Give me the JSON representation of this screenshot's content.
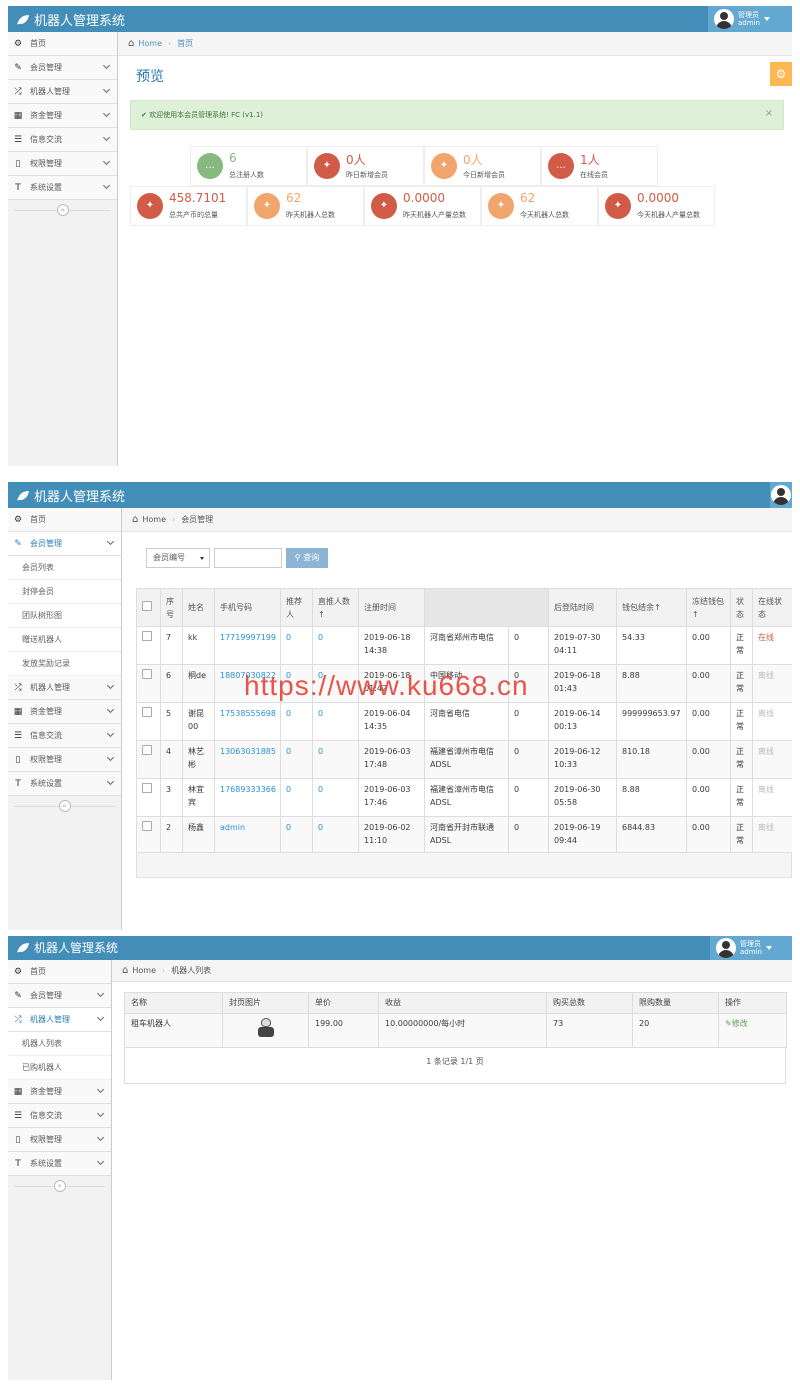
{
  "app_title": "机器人管理系统",
  "user": {
    "role": "管理员",
    "name": "admin"
  },
  "collapse_glyph": "«",
  "panel1": {
    "breadcrumb": {
      "home": "Home",
      "current": "首页"
    },
    "page_title": "预览",
    "alert": "✔ 欢迎使用本会员管理系统! FC (v1.1)",
    "alert_close": "×",
    "nav": [
      {
        "label": "首页",
        "icon": "dashboard-icon",
        "glyph": "⚙",
        "chevron": false
      },
      {
        "label": "会员管理",
        "icon": "edit-icon",
        "glyph": "✎",
        "chevron": true
      },
      {
        "label": "机器人管理",
        "icon": "random-icon",
        "glyph": "⤮",
        "chevron": true
      },
      {
        "label": "资金管理",
        "icon": "calendar-icon",
        "glyph": "▦",
        "chevron": true
      },
      {
        "label": "信息交流",
        "icon": "list-icon",
        "glyph": "☰",
        "chevron": true
      },
      {
        "label": "权限管理",
        "icon": "file-icon",
        "glyph": "▯",
        "chevron": true
      },
      {
        "label": "系统设置",
        "icon": "text-icon",
        "glyph": "T",
        "chevron": true
      }
    ],
    "stats_row1": [
      {
        "value": "6",
        "label": "总注册人数",
        "color": "#87b87f",
        "icon": "comments-icon",
        "glyph": "…"
      },
      {
        "value": "0人",
        "label": "昨日新增会员",
        "color": "#d15b47",
        "icon": "twitter-icon",
        "glyph": "✦"
      },
      {
        "value": "0人",
        "label": "今日新增会员",
        "color": "#f0a56c",
        "icon": "twitter-icon",
        "glyph": "✦"
      },
      {
        "value": "1人",
        "label": "在线会员",
        "color": "#d15b47",
        "icon": "comments-icon",
        "glyph": "…"
      }
    ],
    "stats_row2": [
      {
        "value": "458.7101",
        "label": "总共产币的总量",
        "color": "#d15b47",
        "icon": "twitter-icon",
        "glyph": "✦"
      },
      {
        "value": "62",
        "label": "昨天机器人总数",
        "color": "#f0a56c",
        "icon": "twitter-icon",
        "glyph": "✦"
      },
      {
        "value": "0.0000",
        "label": "昨天机器人产量总数",
        "color": "#d15b47",
        "icon": "twitter-icon",
        "glyph": "✦"
      },
      {
        "value": "62",
        "label": "今天机器人总数",
        "color": "#f0a56c",
        "icon": "twitter-icon",
        "glyph": "✦"
      },
      {
        "value": "0.0000",
        "label": "今天机器人产量总数",
        "color": "#d15b47",
        "icon": "twitter-icon",
        "glyph": "✦"
      }
    ]
  },
  "panel2": {
    "breadcrumb": {
      "home": "Home",
      "current": "会员管理"
    },
    "nav_top": {
      "label": "首页"
    },
    "nav_active": {
      "label": "会员管理"
    },
    "sub_items": [
      "会员列表",
      "封停会员",
      "团队树形图",
      "赠送机器人",
      "发放奖励记录"
    ],
    "nav_rest": [
      "机器人管理",
      "资金管理",
      "信息交流",
      "权限管理",
      "系统设置"
    ],
    "search": {
      "select": "会员编号",
      "button": "查询"
    },
    "columns": [
      "",
      "序号",
      "姓名",
      "手机号码",
      "推荐人",
      "直推人数↑",
      "注册时间",
      "",
      "",
      "后登陆时间",
      "钱包结余↑",
      "冻结钱包↑",
      "状态",
      "在线状态"
    ],
    "rows": [
      [
        "7",
        "kk",
        "17719997199",
        "0",
        "0",
        "2019-06-18 14:38",
        "河南省郑州市电信",
        "0",
        "2019-07-30 04:11",
        "54.33",
        "0.00",
        "正常",
        "在线"
      ],
      [
        "6",
        "桐de",
        "18807030822",
        "0",
        "0",
        "2019-06-18 01:42",
        "中国移动",
        "0",
        "2019-06-18 01:43",
        "8.88",
        "0.00",
        "正常",
        "离线"
      ],
      [
        "5",
        "谢昆00",
        "17538555698",
        "0",
        "0",
        "2019-06-04 14:35",
        "河南省电信",
        "0",
        "2019-06-14 00:13",
        "999999653.97",
        "0.00",
        "正常",
        "离线"
      ],
      [
        "4",
        "林艺彬",
        "13063031885",
        "0",
        "0",
        "2019-06-03 17:48",
        "福建省漳州市电信ADSL",
        "0",
        "2019-06-12 10:33",
        "810.18",
        "0.00",
        "正常",
        "离线"
      ],
      [
        "3",
        "林宜宾",
        "17689333366",
        "0",
        "0",
        "2019-06-03 17:46",
        "福建省漳州市电信ADSL",
        "0",
        "2019-06-30 05:58",
        "8.88",
        "0.00",
        "正常",
        "离线"
      ],
      [
        "2",
        "杨鑫",
        "admin",
        "0",
        "0",
        "2019-06-02 11:10",
        "河南省开封市联通ADSL",
        "0",
        "2019-06-19 09:44",
        "6844.83",
        "0.00",
        "正常",
        "离线"
      ]
    ]
  },
  "panel3": {
    "breadcrumb": {
      "home": "Home",
      "current": "机器人列表"
    },
    "nav_top": {
      "label": "首页"
    },
    "nav_1": {
      "label": "会员管理"
    },
    "nav_active": {
      "label": "机器人管理"
    },
    "sub_items": [
      "机器人列表",
      "已购机器人"
    ],
    "nav_rest": [
      "资金管理",
      "信息交流",
      "权限管理",
      "系统设置"
    ],
    "columns": [
      "名称",
      "封页图片",
      "单价",
      "收益",
      "购买总数",
      "限购数量",
      "操作"
    ],
    "row": {
      "name": "租车机器人",
      "price": "199.00",
      "income": "10.00000000/每小时",
      "total": "73",
      "limit": "20",
      "action": "✎修改"
    },
    "pager": "1 条记录 1/1 页"
  },
  "watermark": "https://www.ku668.cn"
}
